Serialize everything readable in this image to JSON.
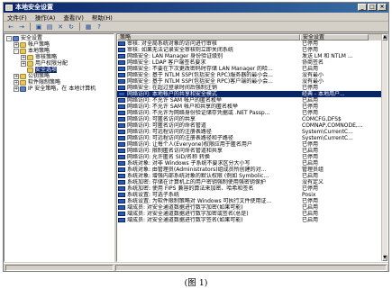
{
  "window": {
    "title": "本地安全设置"
  },
  "menu": [
    "文件(F)",
    "操作(A)",
    "查看(V)",
    "帮助(H)"
  ],
  "toolbar": [
    "back-icon",
    "forward-icon",
    "up-icon",
    "properties-icon",
    "delete-icon",
    "refresh-icon",
    "export-icon",
    "help-icon"
  ],
  "tree": [
    {
      "label": "安全设置",
      "level": 0,
      "exp": "-",
      "icon": "shield"
    },
    {
      "label": "帐户策略",
      "level": 1,
      "exp": "+",
      "icon": "folder"
    },
    {
      "label": "本地策略",
      "level": 1,
      "exp": "-",
      "icon": "folder"
    },
    {
      "label": "审核策略",
      "level": 2,
      "exp": "+",
      "icon": "folder"
    },
    {
      "label": "用户权限分配",
      "level": 2,
      "exp": "+",
      "icon": "folder"
    },
    {
      "label": "安全选项",
      "level": 2,
      "exp": "",
      "icon": "folder",
      "selected": true
    },
    {
      "label": "公钥策略",
      "level": 1,
      "exp": "+",
      "icon": "folder"
    },
    {
      "label": "软件限制策略",
      "level": 1,
      "exp": "+",
      "icon": "folder"
    },
    {
      "label": "IP 安全策略，在 本地计算机",
      "level": 1,
      "exp": "+",
      "icon": "shield"
    }
  ],
  "list": {
    "col_policy": "策略",
    "col_setting": "安全设置",
    "rows": [
      {
        "p": "审核: 对全局系统对象的访问进行审核",
        "s": "已停用"
      },
      {
        "p": "审核: 如果无法记录安全审核则立即关闭系统",
        "s": "已停用"
      },
      {
        "p": "网络安全: LAN Manager 身份验证级别",
        "s": "发送 LM 和 NTLM ..."
      },
      {
        "p": "网络安全: LDAP 客户端签名要求",
        "s": "协商签名"
      },
      {
        "p": "网络安全: 不要在下次更改密码时存储 LAN Manager 的哈...",
        "s": "已启用"
      },
      {
        "p": "网络安全: 基于 NTLM SSP(包括安全 RPC)服务器的最小会...",
        "s": "没有最小"
      },
      {
        "p": "网络安全: 基于 NTLM SSP(包括安全 RPC)客户端的最小会...",
        "s": "没有最小"
      },
      {
        "p": "网络安全: 在超过登录时间后强制注销",
        "s": "已停用"
      },
      {
        "p": "网络访问: 本地帐户的共享和安全模式",
        "s": "经典 - 本地用户...",
        "selected": true
      },
      {
        "p": "网络访问: 不允许 SAM 帐户的匿名枚举",
        "s": "已启用"
      },
      {
        "p": "网络访问: 不允许 SAM 帐户和共享的匿名枚举",
        "s": "已停用"
      },
      {
        "p": "网络访问: 不允许为网络身份验证储存凭据或 .NET Passp...",
        "s": "已停用"
      },
      {
        "p": "网络访问: 可匿名访问的共享",
        "s": "COMCFG,DFS$"
      },
      {
        "p": "网络访问: 可匿名访问的命名管道",
        "s": "COMNAP,COMNODE,..."
      },
      {
        "p": "网络访问: 可远程访问的注册表路径",
        "s": "System\\CurrentC..."
      },
      {
        "p": "网络访问: 可远程访问的注册表路径和子路径",
        "s": "System\\CurrentC..."
      },
      {
        "p": "网络访问: 让每个人(Everyone)权限应用于匿名用户",
        "s": "已停用"
      },
      {
        "p": "网络访问: 限制匿名访问命名管道和共享",
        "s": "已启用"
      },
      {
        "p": "网络访问: 允许匿名 SID/名称 转换",
        "s": "已停用"
      },
      {
        "p": "系统对象: 对非 Windows 子系统不要求区分大小写",
        "s": "已启用"
      },
      {
        "p": "系统对象: 由管理员(Administrators)组成员所创建的对...",
        "s": "管理员组"
      },
      {
        "p": "系统对象: 增强内部系统对象的默认权限 (例如 Symbolic...",
        "s": "已启用"
      },
      {
        "p": "系统加密: 存储在计算机上的用户密钥强制使用强密钥保护",
        "s": "没有定义"
      },
      {
        "p": "系统加密: 使用 FIPS 兼容的算法来加密、哈希和签名",
        "s": "已停用"
      },
      {
        "p": "系统设置: 可选子系统",
        "s": "Posix"
      },
      {
        "p": "系统设置: 为软件限制策略对 Windows 可执行文件使用证...",
        "s": "已停用"
      },
      {
        "p": "域成员: 对安全通道数据进行数字加密(如果可能)",
        "s": "已启用"
      },
      {
        "p": "域成员: 对安全通道数据进行数字加密或签名(总是)",
        "s": "已启用"
      },
      {
        "p": "域成员: 对安全通道数据进行数字签名(如果可能)",
        "s": "已启用"
      }
    ]
  },
  "caption": "(图 1)"
}
